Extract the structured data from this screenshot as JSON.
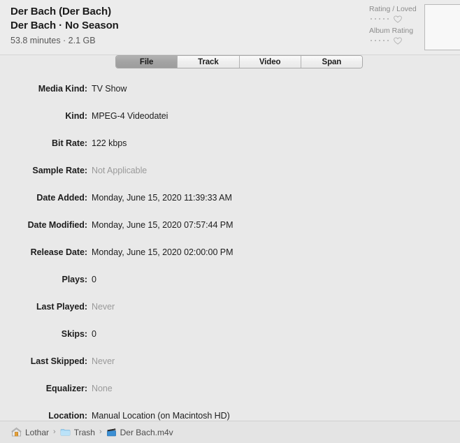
{
  "header": {
    "title": "Der Bach (Der Bach)",
    "subtitle_show": "Der Bach · No Season",
    "meta": "53.8 minutes · 2.1 GB",
    "rating_label": "Rating / Loved",
    "album_rating_label": "Album Rating",
    "rating_stars_empty": 5,
    "album_rating_stars_empty": 5,
    "loved_icon": "heart-outline-icon",
    "album_loved_icon": "heart-outline-icon",
    "artwork_placeholder": ""
  },
  "tabs": [
    {
      "label": "File",
      "selected": true
    },
    {
      "label": "Track",
      "selected": false
    },
    {
      "label": "Video",
      "selected": false
    },
    {
      "label": "Span",
      "selected": false
    }
  ],
  "fields": [
    {
      "label": "Media Kind:",
      "value": "TV Show",
      "muted": false
    },
    {
      "label": "Kind:",
      "value": "MPEG-4 Videodatei",
      "muted": false
    },
    {
      "label": "Bit Rate:",
      "value": "122 kbps",
      "muted": false
    },
    {
      "label": "Sample Rate:",
      "value": "Not Applicable",
      "muted": true
    },
    {
      "label": "Date Added:",
      "value": "Monday, June 15, 2020 11:39:33 AM",
      "muted": false
    },
    {
      "label": "Date Modified:",
      "value": "Monday, June 15, 2020 07:57:44 PM",
      "muted": false
    },
    {
      "label": "Release Date:",
      "value": "Monday, June 15, 2020 02:00:00 PM",
      "muted": false
    },
    {
      "label": "Plays:",
      "value": "0",
      "muted": false
    },
    {
      "label": "Last Played:",
      "value": "Never",
      "muted": true
    },
    {
      "label": "Skips:",
      "value": "0",
      "muted": false
    },
    {
      "label": "Last Skipped:",
      "value": "Never",
      "muted": true
    },
    {
      "label": "Equalizer:",
      "value": "None",
      "muted": true
    },
    {
      "label": "Location:",
      "value": "Manual Location (on Macintosh HD)",
      "muted": false
    }
  ],
  "pathbar": {
    "separator": "›",
    "crumbs": [
      {
        "label": "Lothar",
        "icon": "home-folder-icon"
      },
      {
        "label": "Trash",
        "icon": "folder-icon"
      },
      {
        "label": "Der Bach.m4v",
        "icon": "movie-clapperboard-icon"
      }
    ]
  },
  "colors": {
    "window_bg": "#e9e9e9",
    "header_bg": "#ececec",
    "pathbar_bg": "#e4e4e4",
    "text": "#1d1d1d",
    "muted_text": "#9a9a9a",
    "tab_selected_bg": "#a3a3a3",
    "folder_blue": "#9fd3f2"
  }
}
